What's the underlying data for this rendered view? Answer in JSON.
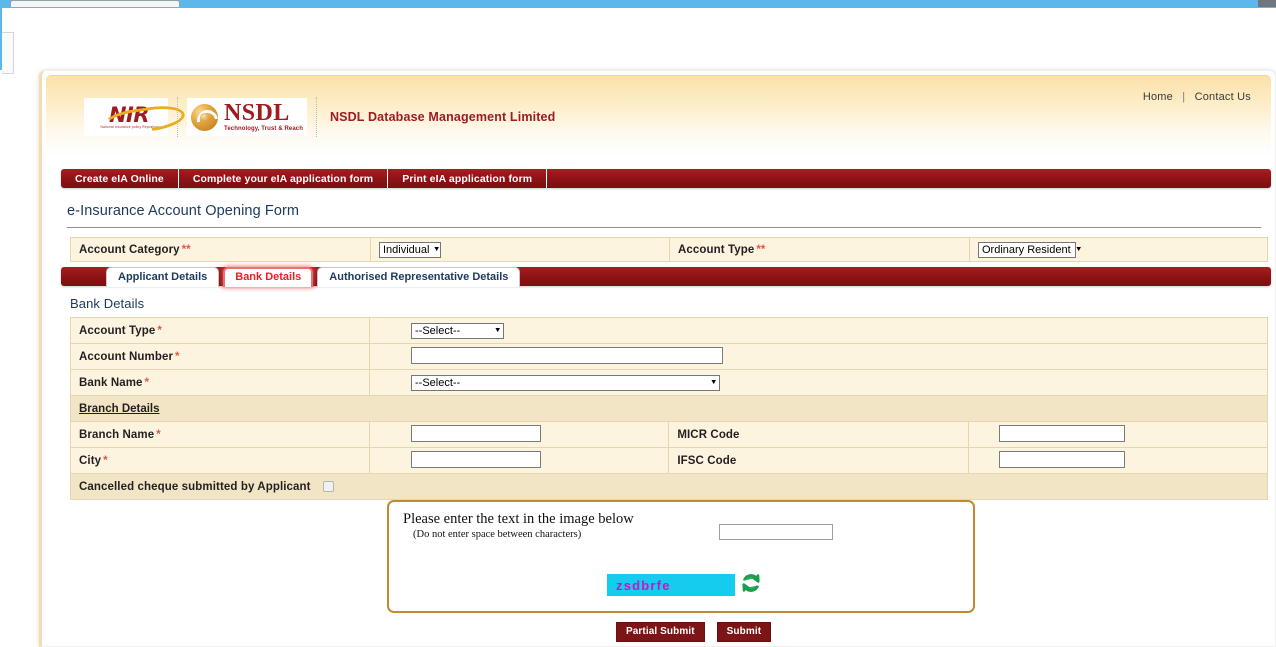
{
  "browser": {
    "tab_strip_color": "#5cb8ea"
  },
  "header": {
    "utility_nav": [
      {
        "label": "Home"
      },
      {
        "label": "Contact Us"
      }
    ],
    "separator": "|",
    "logos": {
      "nir": {
        "main": "NIR",
        "sub": "National Insurance policy Repository"
      },
      "nsdl": {
        "main": "NSDL",
        "tagline": "Technology, Trust & Reach"
      }
    },
    "company_name": "NSDL Database Management Limited",
    "brand_color": "#9e1b20",
    "gradient_top": "#fbe1a9"
  },
  "main_nav": {
    "items": [
      {
        "label": "Create eIA Online"
      },
      {
        "label": "Complete your eIA application form"
      },
      {
        "label": "Print eIA application form"
      }
    ],
    "bar_color": "#8d1214"
  },
  "page": {
    "title": "e-Insurance Account Opening Form"
  },
  "category_bar": {
    "account_category": {
      "label": "Account Category",
      "required_mark": "**",
      "value": "Individual"
    },
    "account_type": {
      "label": "Account Type",
      "required_mark": "**",
      "value": "Ordinary Resident"
    }
  },
  "tabs": [
    {
      "label": "Applicant Details",
      "active": false
    },
    {
      "label": "Bank Details",
      "active": true
    },
    {
      "label": "Authorised Representative Details",
      "active": false
    }
  ],
  "section": {
    "title": "Bank Details",
    "active_tab_color": "#ee1c25"
  },
  "bank_form": {
    "account_type": {
      "label": "Account Type",
      "required_mark": "*",
      "value": "--Select--"
    },
    "account_number": {
      "label": "Account Number",
      "required_mark": "*",
      "value": "",
      "placeholder": ""
    },
    "bank_name": {
      "label": "Bank Name",
      "required_mark": "*",
      "value": "--Select--"
    },
    "branch_details_header": "Branch Details",
    "branch_name": {
      "label": "Branch Name",
      "required_mark": "*",
      "value": "",
      "placeholder": ""
    },
    "micr_code": {
      "label": "MICR Code",
      "value": "",
      "placeholder": ""
    },
    "city": {
      "label": "City",
      "required_mark": "*",
      "value": "",
      "placeholder": ""
    },
    "ifsc_code": {
      "label": "IFSC Code",
      "value": "",
      "placeholder": ""
    },
    "cancelled_cheque": {
      "label": "Cancelled cheque submitted by Applicant",
      "checked": false
    }
  },
  "captcha": {
    "prompt": "Please enter the text in the image below",
    "note": "(Do not enter space between characters)",
    "input_value": "",
    "input_placeholder": "",
    "image_text": "zsdbrfe",
    "image_bg_color": "#14ccee",
    "image_text_color": "#c417c4",
    "refresh_icon": "refresh-icon",
    "refresh_icon_color": "#1a9e4b"
  },
  "buttons": [
    {
      "label": "Partial Submit"
    },
    {
      "label": "Submit"
    }
  ],
  "button_color": "#7d1416"
}
